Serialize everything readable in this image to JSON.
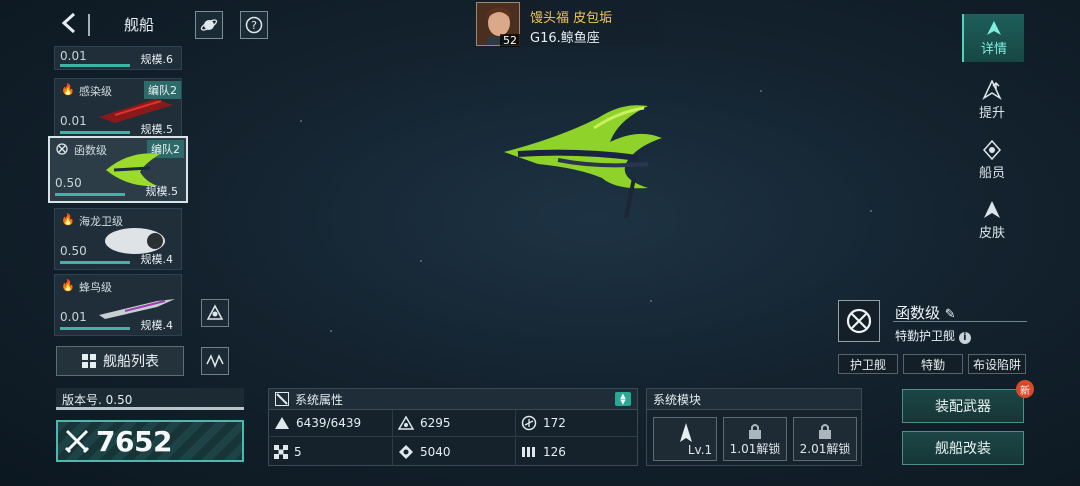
{
  "header": {
    "title": "舰船",
    "player_name": "馒头福 皮包垢",
    "player_level": "52",
    "server": "G16.鲸鱼座"
  },
  "ship_list": [
    {
      "name": "",
      "version": "0.01",
      "scale": "规模.6",
      "fleet": "",
      "progress": 0.95
    },
    {
      "name": "感染级",
      "version": "0.01",
      "scale": "规模.5",
      "fleet": "编队2",
      "progress": 0.95
    },
    {
      "name": "函数级",
      "version": "0.50",
      "scale": "规模.5",
      "fleet": "编队2",
      "progress": 0.6,
      "selected": true
    },
    {
      "name": "海龙卫级",
      "version": "0.50",
      "scale": "规模.4",
      "fleet": "",
      "progress": 0.95
    },
    {
      "name": "蜂鸟级",
      "version": "0.01",
      "scale": "规模.4",
      "fleet": "",
      "progress": 0.95
    }
  ],
  "ship_list_button": "舰船列表",
  "right_nav": {
    "details": "详情",
    "upgrade": "提升",
    "crew": "船员",
    "skin": "皮肤"
  },
  "ship_info": {
    "name": "函数级",
    "subtitle": "特勤护卫舰",
    "tags": [
      "护卫舰",
      "特勤",
      "布设陷阱"
    ]
  },
  "version_panel": {
    "label": "版本号. 0.50",
    "power": "7652"
  },
  "attributes": {
    "title": "系统属性",
    "items": [
      {
        "icon": "hull-icon",
        "value": "6439/6439"
      },
      {
        "icon": "armor-icon",
        "value": "6295"
      },
      {
        "icon": "shield-icon",
        "value": "172"
      },
      {
        "icon": "grid-icon",
        "value": "5"
      },
      {
        "icon": "target-icon",
        "value": "5040"
      },
      {
        "icon": "speed-icon",
        "value": "126"
      }
    ]
  },
  "modules": {
    "title": "系统模块",
    "slots": [
      {
        "label": "Lv.1",
        "locked": false
      },
      {
        "label": "1.01解锁",
        "locked": true
      },
      {
        "label": "2.01解锁",
        "locked": true
      }
    ]
  },
  "actions": {
    "equip": "装配武器",
    "modify": "舰船改装",
    "new_badge": "新"
  },
  "colors": {
    "accent": "#4bb9ab",
    "ship_green": "#9bdc2a",
    "gold": "#f2c95a"
  }
}
